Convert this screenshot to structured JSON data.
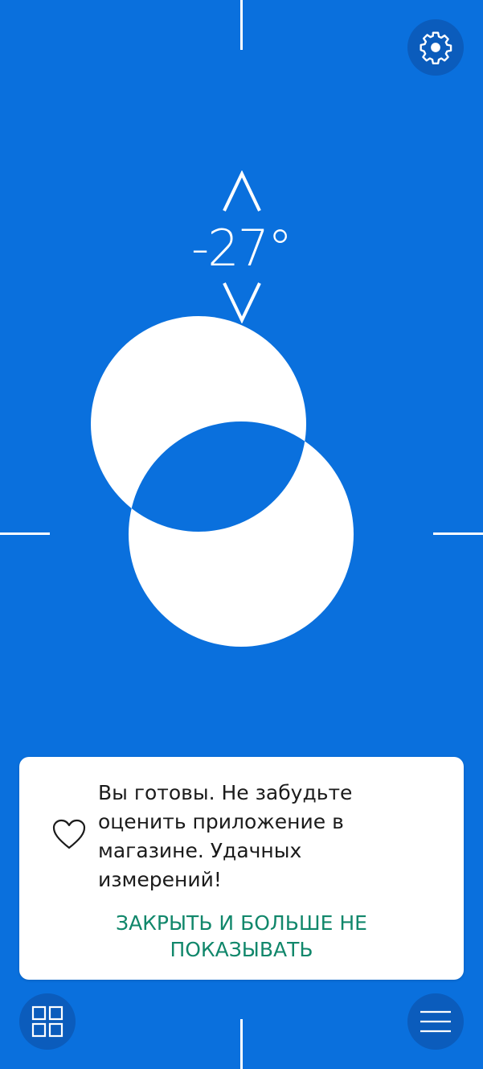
{
  "level": {
    "angle_text": "-27°"
  },
  "toast": {
    "message": "Вы готовы. Не забудьте оценить приложение в магазине. Удачных измерений!",
    "action_label": "ЗАКРЫТЬ И БОЛЬШЕ НЕ ПОКАЗЫВАТЬ"
  },
  "icons": {
    "settings": "gear-icon",
    "grid": "grid-icon",
    "menu": "hamburger-menu-icon",
    "heart": "heart-icon",
    "increase": "chevron-up-icon",
    "decrease": "chevron-down-icon"
  },
  "colors": {
    "background": "#0a70dd",
    "button_background": "#0b5cbc",
    "bubble": "#ffffff",
    "action_text": "#11876b"
  }
}
